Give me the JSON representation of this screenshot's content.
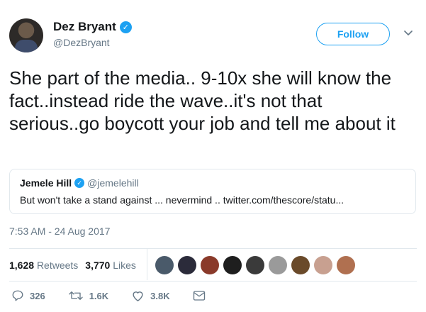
{
  "author": {
    "display_name": "Dez Bryant",
    "handle": "@DezBryant",
    "verified_glyph": "✓"
  },
  "follow_label": "Follow",
  "tweet_text": "She part of the media.. 9-10x she will know the fact..instead ride the wave..it's not that serious..go boycott your job and tell me about it",
  "quoted_tweet": {
    "display_name": "Jemele Hill",
    "handle": "@jemelehill",
    "text": "But won't take a stand against ... nevermind .. twitter.com/thescore/statu..."
  },
  "timestamp": "7:53 AM - 24 Aug 2017",
  "stats": {
    "retweets_count": "1,628",
    "retweets_label": "Retweets",
    "likes_count": "3,770",
    "likes_label": "Likes"
  },
  "liker_avatar_colors": [
    "#4a5a6a",
    "#2b2b3a",
    "#8a3a2a",
    "#1e1e1e",
    "#3a3a3a",
    "#9a9a9a",
    "#6a4a2a",
    "#c8a090",
    "#b07050"
  ],
  "actions": {
    "reply_count": "326",
    "retweet_count": "1.6K",
    "like_count": "3.8K"
  },
  "colors": {
    "accent": "#1da1f2",
    "secondary_text": "#657786",
    "border": "#e1e8ed"
  }
}
